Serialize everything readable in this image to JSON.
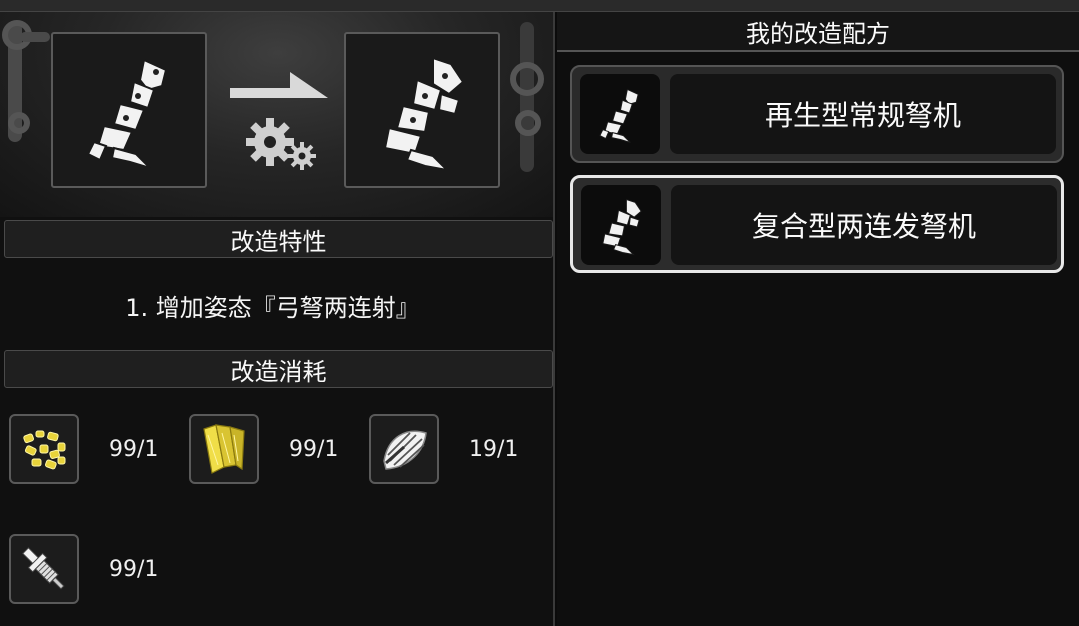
{
  "left_panel": {
    "source_item_icon": "crossbow-mechanism-icon",
    "result_item_icon": "crossbow-mechanism-upgraded-icon",
    "upgrade_arrow_icon": "arrow-gear-icon",
    "trait_section_title": "改造特性",
    "trait_text": "1. 增加姿态『弓弩两连射』",
    "cost_section_title": "改造消耗",
    "costs": [
      {
        "icon": "gold-nuggets-icon",
        "count": "99/1"
      },
      {
        "icon": "gold-wood-plank-icon",
        "count": "99/1"
      },
      {
        "icon": "steel-plate-icon",
        "count": "19/1"
      },
      {
        "icon": "drill-tool-icon",
        "count": "99/1"
      }
    ]
  },
  "right_panel": {
    "title": "我的改造配方",
    "recipes": [
      {
        "label": "再生型常规弩机",
        "icon": "crossbow-mechanism-icon",
        "selected": false
      },
      {
        "label": "复合型两连发弩机",
        "icon": "crossbow-mechanism-upgraded-icon",
        "selected": true
      }
    ]
  },
  "colors": {
    "background": "#0b0b0b",
    "gold": "#e8d33a",
    "selected_border": "#e8e8e8"
  }
}
